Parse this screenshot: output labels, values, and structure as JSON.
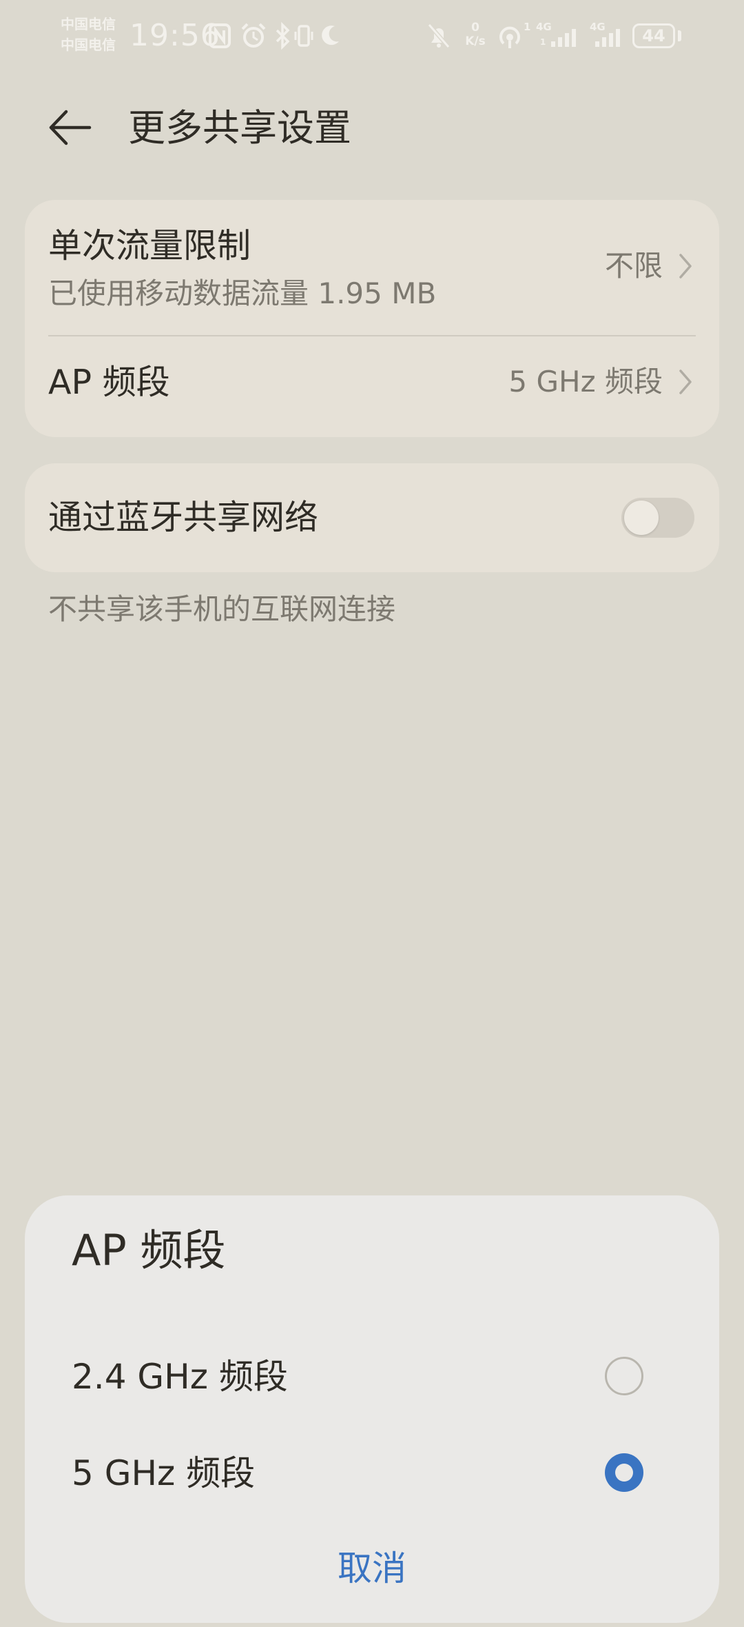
{
  "status_bar": {
    "carrier_1": "中国电信",
    "carrier_2": "中国电信",
    "time": "19:56",
    "net_speed_value": "0",
    "net_speed_unit": "K/s",
    "hotspot_badge": "1",
    "sim1_type": "4G",
    "sim1_sub": "1",
    "sim2_type": "4G",
    "battery": "44"
  },
  "header": {
    "title": "更多共享设置"
  },
  "settings": {
    "data_limit": {
      "title": "单次流量限制",
      "subtitle": "已使用移动数据流量 1.95 MB",
      "value": "不限"
    },
    "ap_band": {
      "title": "AP 频段",
      "value": "5 GHz 频段"
    },
    "bluetooth_share": {
      "title": "通过蓝牙共享网络",
      "enabled": false
    },
    "footnote": "不共享该手机的互联网连接"
  },
  "dialog": {
    "title": "AP 频段",
    "options": [
      {
        "label": "2.4 GHz 频段",
        "selected": false
      },
      {
        "label": "5 GHz 频段",
        "selected": true
      }
    ],
    "cancel_label": "取消"
  },
  "colors": {
    "background": "#dcd9cf",
    "card": "#e6e1d7",
    "dialog": "#eae9e7",
    "accent": "#3a74c2"
  },
  "icons": {
    "status_bar": [
      "nfc-icon",
      "alarm-icon",
      "bluetooth-icon",
      "vibrate-icon",
      "do-not-disturb-moon-icon",
      "mute-bell-icon",
      "hotspot-icon",
      "signal-icon",
      "battery-icon"
    ],
    "header": [
      "back-arrow-icon"
    ],
    "rows": [
      "chevron-right-icon"
    ]
  }
}
